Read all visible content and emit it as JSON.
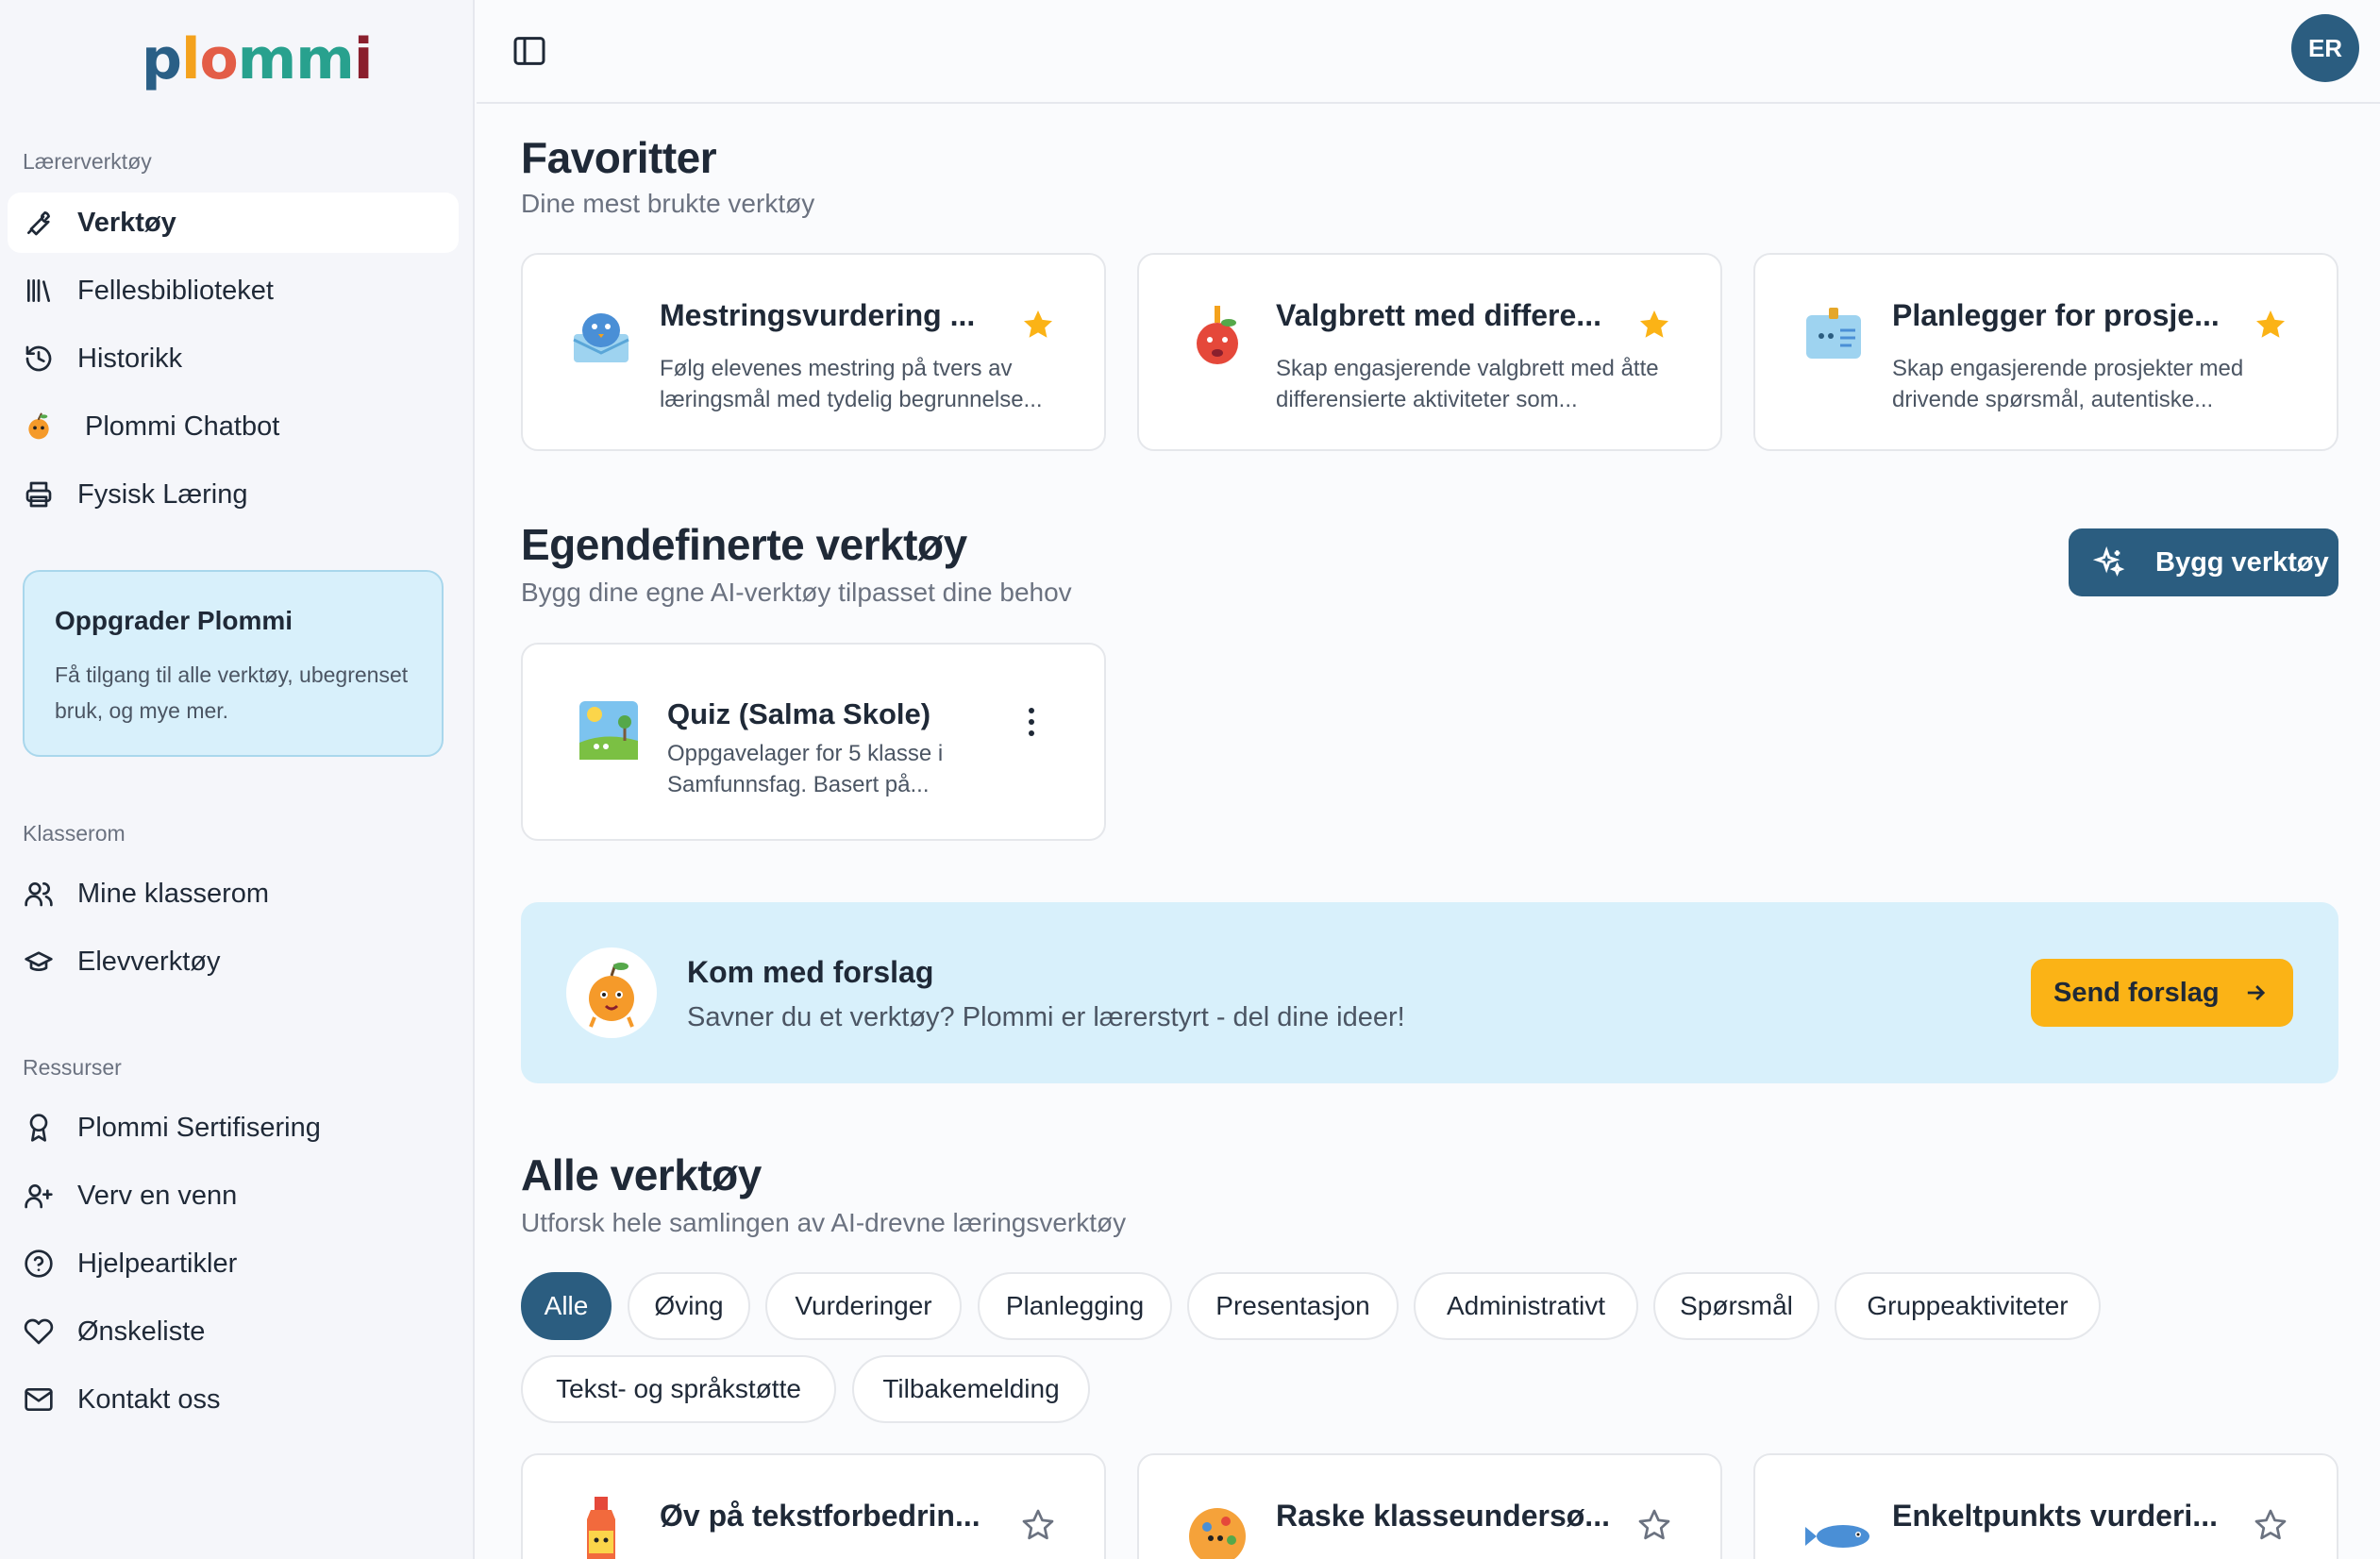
{
  "app": {
    "logo_letters": [
      "p",
      "l",
      "o",
      "mm",
      "i"
    ],
    "user_initials": "ER"
  },
  "sidebar": {
    "section_teacher": "Lærerverktøy",
    "teacher_items": [
      {
        "label": "Verktøy",
        "icon": "wrench-icon"
      },
      {
        "label": "Fellesbiblioteket",
        "icon": "library-icon"
      },
      {
        "label": "Historikk",
        "icon": "history-icon"
      },
      {
        "label": "Plommi Chatbot",
        "icon": "plommi-mascot-icon"
      },
      {
        "label": "Fysisk Læring",
        "icon": "printer-icon"
      }
    ],
    "upgrade": {
      "title": "Oppgrader Plommi",
      "text": "Få tilgang til alle verktøy, ubegrenset bruk, og mye mer."
    },
    "section_classroom": "Klasserom",
    "classroom_items": [
      {
        "label": "Mine klasserom",
        "icon": "users-icon"
      },
      {
        "label": "Elevverktøy",
        "icon": "graduation-cap-icon"
      }
    ],
    "section_resources": "Ressurser",
    "resource_items": [
      {
        "label": "Plommi Sertifisering",
        "icon": "award-icon"
      },
      {
        "label": "Verv en venn",
        "icon": "user-plus-icon"
      },
      {
        "label": "Hjelpeartikler",
        "icon": "help-circle-icon"
      },
      {
        "label": "Ønskeliste",
        "icon": "heart-icon"
      },
      {
        "label": "Kontakt oss",
        "icon": "mail-icon"
      }
    ]
  },
  "favorites": {
    "title": "Favoritter",
    "subtitle": "Dine mest brukte verktøy",
    "cards": [
      {
        "title": "Mestringsvurdering ...",
        "desc": "Følg elevenes mestring på tvers av læringsmål med tydelig begrunnelse..."
      },
      {
        "title": "Valgbrett med differe...",
        "desc": "Skap engasjerende valgbrett med åtte differensierte aktiviteter som..."
      },
      {
        "title": "Planlegger for prosje...",
        "desc": "Skap engasjerende prosjekter med drivende spørsmål, autentiske..."
      }
    ]
  },
  "custom": {
    "title": "Egendefinerte verktøy",
    "subtitle": "Bygg dine egne AI-verktøy tilpasset dine behov",
    "build_label": "Bygg verktøy",
    "card": {
      "title": "Quiz (Salma Skole)",
      "desc": "Oppgavelager for 5 klasse i Samfunnsfag. Basert på..."
    }
  },
  "suggest": {
    "title": "Kom med forslag",
    "text": "Savner du et verktøy? Plommi er lærerstyrt - del dine ideer!",
    "button": "Send forslag"
  },
  "all_tools": {
    "title": "Alle verktøy",
    "subtitle": "Utforsk hele samlingen av AI-drevne læringsverktøy",
    "filters": [
      "Alle",
      "Øving",
      "Vurderinger",
      "Planlegging",
      "Presentasjon",
      "Administrativt",
      "Spørsmål",
      "Gruppeaktiviteter",
      "Tekst- og språkstøtte",
      "Tilbakemelding"
    ],
    "active_filter": "Alle",
    "cards": [
      {
        "title": "Øv på tekstforbedrin..."
      },
      {
        "title": "Raske klasseundersø..."
      },
      {
        "title": "Enkeltpunkts vurderi..."
      }
    ]
  },
  "colors": {
    "primary": "#2b5d80",
    "accent_yellow": "#fbb316",
    "light_blue": "#d8f0fb",
    "star": "#fbb316"
  }
}
